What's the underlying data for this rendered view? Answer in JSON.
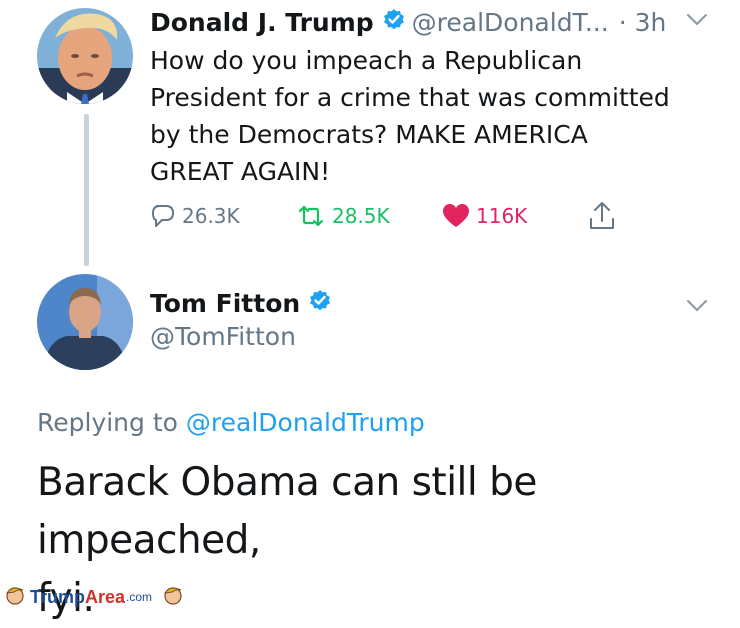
{
  "colors": {
    "link": "#1da1f2",
    "muted": "#657786",
    "text": "#14171a",
    "retweet": "#17bf63",
    "like": "#e0245e",
    "verified": "#1da1f2"
  },
  "tweet": {
    "author_name": "Donald J. Trump",
    "author_handle": "@realDonaldT...",
    "time": "· 3h",
    "lines": [
      "How do you impeach a Republican",
      "President for a crime that was committed",
      "by the Democrats? MAKE AMERICA",
      "GREAT AGAIN!"
    ],
    "replies": "26.3K",
    "retweets": "28.5K",
    "likes": "116K",
    "icons": [
      "verified-badge-icon",
      "chevron-down-icon",
      "reply-icon",
      "retweet-icon",
      "heart-icon",
      "share-icon"
    ]
  },
  "reply": {
    "author_name": "Tom Fitton",
    "author_handle": "@TomFitton",
    "replying_prefix": "Replying to",
    "replying_handle": "@realDonaldTrump",
    "lines": [
      "Barack Obama can still be impeached,",
      "fyi."
    ]
  },
  "watermark": {
    "trump": "Trump",
    "area": "Area",
    "domain": ".com"
  }
}
